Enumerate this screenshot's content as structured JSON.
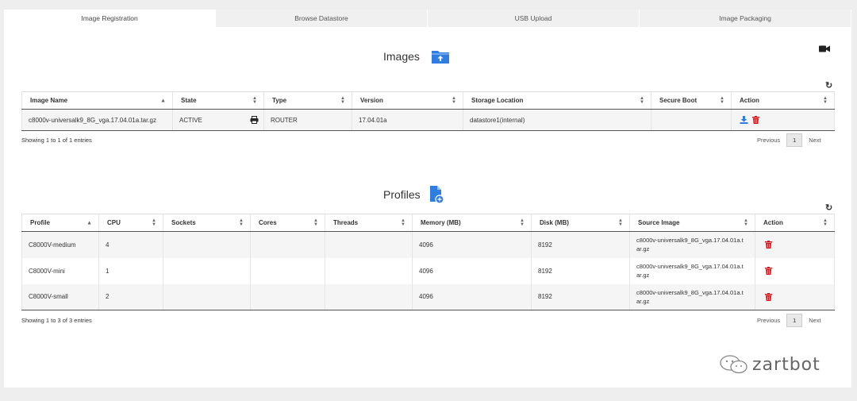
{
  "tabs": [
    {
      "label": "Image Registration",
      "active": true
    },
    {
      "label": "Browse Datastore",
      "active": false
    },
    {
      "label": "USB Upload",
      "active": false
    },
    {
      "label": "Image Packaging",
      "active": false
    }
  ],
  "images": {
    "title": "Images",
    "title_icon": "folder-upload-icon",
    "columns": [
      "Image Name",
      "State",
      "Type",
      "Version",
      "Storage Location",
      "Secure Boot",
      "Action"
    ],
    "rows": [
      {
        "image_name": "c8000v-universalk9_8G_vga.17.04.01a.tar.gz",
        "state": "ACTIVE",
        "type": "ROUTER",
        "version": "17.04.01a",
        "storage_location": "datastore1(internal)",
        "secure_boot": ""
      }
    ],
    "info": "Showing 1 to 1 of 1 entries"
  },
  "profiles": {
    "title": "Profiles",
    "title_icon": "file-add-icon",
    "columns": [
      "Profile",
      "CPU",
      "Sockets",
      "Cores",
      "Threads",
      "Memory (MB)",
      "Disk (MB)",
      "Source Image",
      "Action"
    ],
    "rows": [
      {
        "profile": "C8000V-medium",
        "cpu": "4",
        "sockets": "",
        "cores": "",
        "threads": "",
        "memory": "4096",
        "disk": "8192",
        "source_line1": "c8000v-universalk9_8G_vga.17.04.01a.t",
        "source_line2": "ar.gz"
      },
      {
        "profile": "C8000V-mini",
        "cpu": "1",
        "sockets": "",
        "cores": "",
        "threads": "",
        "memory": "4096",
        "disk": "8192",
        "source_line1": "c8000v-universalk9_8G_vga.17.04.01a.t",
        "source_line2": "ar.gz"
      },
      {
        "profile": "C8000V-small",
        "cpu": "2",
        "sockets": "",
        "cores": "",
        "threads": "",
        "memory": "4096",
        "disk": "8192",
        "source_line1": "c8000v-universalk9_8G_vga.17.04.01a.t",
        "source_line2": "ar.gz"
      }
    ],
    "info": "Showing 1 to 3 of 3 entries"
  },
  "pager": {
    "previous": "Previous",
    "page": "1",
    "next": "Next"
  },
  "watermark": {
    "text": "zartbot"
  },
  "colors": {
    "accent_blue": "#2f7de1",
    "delete_red": "#d9141b"
  }
}
